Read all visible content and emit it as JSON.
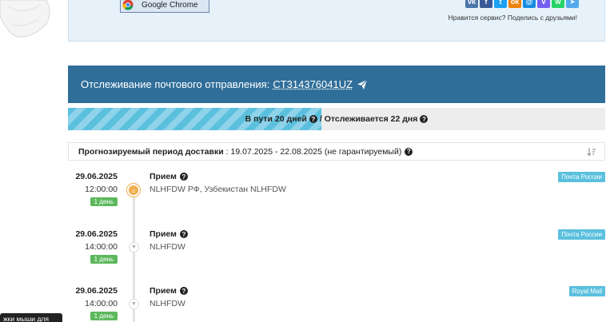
{
  "top": {
    "chrome_label": "Google Chrome",
    "share_text": "Нравится сервис? Поделись с друзьями!",
    "share_icons": [
      "vk-icon",
      "facebook-icon",
      "twitter-icon",
      "odnoklassniki-icon",
      "mailru-icon",
      "viber-icon",
      "whatsapp-icon",
      "telegram-icon"
    ]
  },
  "header": {
    "label": "Отслеживание почтового отправления:",
    "tracking_number": "CT314376041UZ"
  },
  "progress": {
    "in_transit": "В пути 20 дней",
    "separator": "/",
    "tracked": "Отслеживается 22 дня",
    "fill_fraction": 0.471
  },
  "forecast": {
    "label": "Прогнозируемый период доставки",
    "value": ": 19.07.2025 - 22.08.2025 (не гарантируемый)"
  },
  "events": [
    {
      "date": "29.06.2025",
      "time": "12:00:00",
      "days": "1 день",
      "title": "Прием",
      "location": "NLHFDW РФ, Узбекистан NLHFDW",
      "carrier": "Почта России"
    },
    {
      "date": "29.06.2025",
      "time": "14:00:00",
      "days": "1 день",
      "title": "Прием",
      "location": "NLHFDW",
      "carrier": "Почта России"
    },
    {
      "date": "29.06.2025",
      "time": "14:00:00",
      "days": "1 день",
      "title": "Прием",
      "location": "NLHFDW",
      "carrier": "Royal Mail"
    }
  ],
  "tooltip": {
    "text": "жки мыши для"
  },
  "colors": {
    "header_bg": "#2f6e99",
    "progress": "#5bc0de",
    "days_badge": "#5cb85c",
    "carrier_badge": "#5bc0de",
    "orange_dot": "#f0ad4e"
  }
}
